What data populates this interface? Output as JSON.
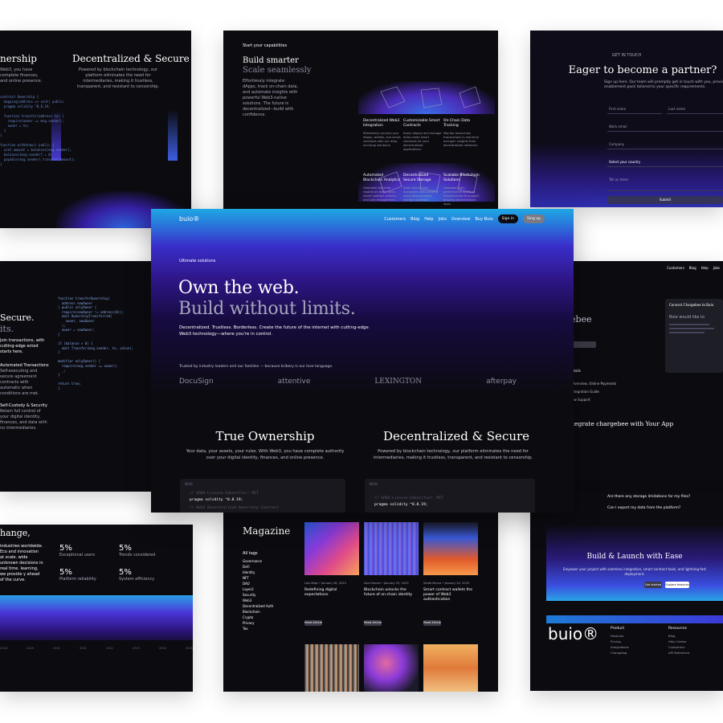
{
  "cards": {
    "c1": {
      "heading_left": "nership",
      "heading_right": "Decentralized & Secure",
      "body_right": "Powered by blockchain technology, our platform eliminates the need for intermediaries, making it trustless, transparent, and resistant to censorship.",
      "body_left": "Web3, you have complete finances, and online presence.",
      "code": "contract Ownership {\n  mapping(address => uint) public\n  pragma solidity ^0.8.19;\n\n  function transfer(address to) {\n    require(owner == msg.sender);\n    owner = to;\n  }\n}\n\nfunction withdraw() public {\n  uint amount = balances[msg.sender];\n  balances[msg.sender] = 0;\n  payable(msg.sender).transfer(amount);\n}"
    },
    "c2": {
      "label": "Start your capabilities",
      "h1": "Build smarter",
      "h2": "Scale seamlessly",
      "body": "Effortlessly integrate dApps, track on-chain data, and automate insights with powerful Web3-native solutions. The future is decentralized—build with confidence.",
      "features": [
        {
          "title": "Decentralized Web3 Integration",
          "desc": "Effortlessly connect your dApps, wallets, and smart contracts with our drop-and-drop solutions."
        },
        {
          "title": "Customizable Smart Contracts",
          "desc": "Easily deploy and manage tailor-made smart contracts for your decentralized applications."
        },
        {
          "title": "On-Chain Data Tracking",
          "desc": "Monitor blockchain transactions in real-time and gain insights from decentralized networks."
        },
        {
          "title": "Automated Blockchain Analytics",
          "desc": "Generate real-time reports on token flows, smart contract activity, and user engagement."
        },
        {
          "title": "Decentralized Secure Storage",
          "desc": "Store and access encrypted data securely using decentralized storage solutions."
        },
        {
          "title": "Scalable Blockchain Solutions",
          "desc": "Leverage high-performance scalable infrastructure to support growing decentralized apps."
        }
      ]
    },
    "c3": {
      "label": "GET IN TOUCH",
      "heading": "Eager to become a partner?",
      "body": "Sign up here. Our team will promptly get in touch with you, providing an enablement pack tailored to your specific requirements.",
      "fields": [
        "First name",
        "Last name",
        "Work email",
        "Company",
        "Select your country",
        "Tell us more"
      ],
      "submit": "Submit"
    },
    "c4": {
      "h1": "Secure.",
      "h2": "its.",
      "body": "Join transactions, with cutting-edge ected starts here.",
      "items": [
        "Automated Transactions",
        "Self-executing and secure agreement contracts with automatic when conditions are met.",
        "Self-Custody & Security",
        "Retain full control of your digital identity, finances, and data with no intermediaries."
      ],
      "code": "function transferOwnership(\n  address newOwner\n) public onlyOwner {\n  require(newOwner != address(0));\n  emit OwnershipTransferred(\n    owner, newOwner\n  );\n  owner = newOwner;\n}\n\nif (balance > 0) {\n  emit Transfer(msg.sender, to, value);\n}\n\nmodifier onlyOwner() {\n  require(msg.sender == owner);\n  _;\n}\n\nreturn true;\n}"
    },
    "c5": {
      "heading": "hange,",
      "body": "industries worldwide. Eco and innovation at scale. wide unknown decisions in real time. learning, we provide y ahead of the curve.",
      "stats": [
        {
          "value": "5%",
          "label": "Exceptional users"
        },
        {
          "value": "5%",
          "label": "Trends considered"
        },
        {
          "value": "5%",
          "label": "Platform reliability"
        },
        {
          "value": "5%",
          "label": "System efficiency"
        }
      ],
      "axis": [
        "2018",
        "2019",
        "2020",
        "2021",
        "2022",
        "2023",
        "2024",
        "2025"
      ]
    },
    "magazine": {
      "heading": "Magazine",
      "tags": [
        "All tags",
        "Governance",
        "DeFi",
        "Identity",
        "NFT",
        "DAO",
        "Layer2",
        "Security",
        "Web3",
        "Decentralized Auth",
        "Blockchain",
        "Crypto",
        "Privacy",
        "Tax"
      ],
      "posts": [
        {
          "meta": "Lois Wise • January 26, 2025",
          "title": "Redefining digital expectations",
          "read": "Read Article"
        },
        {
          "meta": "Sam Nunez • January 25, 2025",
          "title": "Blockchain unlocks the future of on-chain identity",
          "read": "Read Article"
        },
        {
          "meta": "Violet Bruno • January 24, 2025",
          "title": "Smart contract wallets the power of Web3 authentication",
          "read": "Read Article"
        }
      ]
    },
    "c7": {
      "nav": [
        "Customers",
        "Blog",
        "Help",
        "Jobs"
      ],
      "heading": "ebee",
      "panel_title": "Connect Chargebee to Buio",
      "panel_sub": "Role would like to",
      "links": [
        "ntails",
        "Overview, Online Payments",
        "ntegration Guide",
        "ow Support"
      ],
      "h2": "tegrate chargebee with Your App"
    },
    "c8": {
      "q1": "Are there any storage limitations for my files?",
      "q2": "Can I export my data from the platform?",
      "heading": "Build & Launch with Ease",
      "body": "Empower your project with seamless integration, smart contract tools, and lightning-fast deployment.",
      "btn1": "Get started",
      "btn2": "Explore features",
      "brand": "buio®",
      "col1_h": "Product",
      "col1": [
        "Features",
        "Pricing",
        "Integrations",
        "Changelog"
      ],
      "col2_h": "Resources",
      "col2": [
        "Blog",
        "Help Center",
        "Customers",
        "API Reference"
      ]
    }
  },
  "main": {
    "logo": "buio®",
    "nav": [
      "Customers",
      "Blog",
      "Help",
      "Jobs",
      "Overview",
      "Buy Buio"
    ],
    "signin": "Sign in",
    "signup": "Sing up",
    "eyebrow": "Ultimate solutions",
    "h1": "Own the web.",
    "h2": "Build without limits.",
    "sub": "Decentralized. Trustless. Borderless. Create the future of the internet with cutting-edge Web3 technology—where you're in control.",
    "trusted": "Trusted by industry leaders and our families — because bribery is our love language.",
    "logos": [
      "DocuSign",
      "attentive",
      "LEXINGTON",
      "afterpay"
    ],
    "features": [
      {
        "title": "True Ownership",
        "body": "Your data, your assets, your rules. With Web3, you have complete authority over your digital identity, finances, and online presence."
      },
      {
        "title": "Decentralized & Secure",
        "body": "Powered by blockchain technology, our platform eliminates the need for intermediaries, making it trustless, transparent, and resistant to censorship."
      }
    ],
    "code": {
      "header": "0010",
      "comment": "// SPDX-License-Identifier: MIT",
      "line": "pragma solidity ^0.8.19;",
      "line2": "// Web3 Decentralized Ownership Contract"
    }
  }
}
